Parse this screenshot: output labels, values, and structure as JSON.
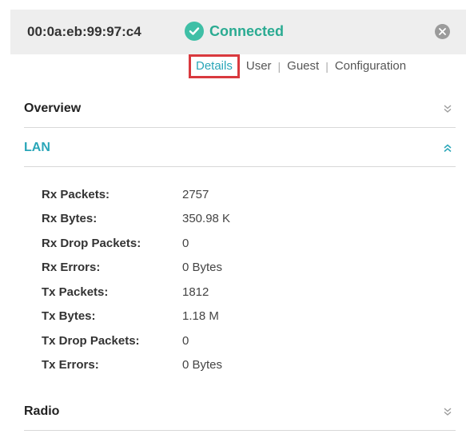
{
  "header": {
    "mac": "00:0a:eb:99:97:c4",
    "status": "Connected",
    "status_color": "#3fbfa6"
  },
  "tabs": [
    {
      "label": "Details",
      "active": true
    },
    {
      "label": "User"
    },
    {
      "label": "Guest"
    },
    {
      "label": "Configuration"
    }
  ],
  "sections": {
    "overview": {
      "title": "Overview",
      "icon": "chevron-double-down-icon"
    },
    "lan": {
      "title": "LAN",
      "icon": "chevron-double-up-icon"
    },
    "radio": {
      "title": "Radio",
      "icon": "chevron-double-down-icon"
    }
  },
  "lan": {
    "rows": [
      {
        "key": "Rx Packets:",
        "value": "2757"
      },
      {
        "key": "Rx Bytes:",
        "value": "350.98 K"
      },
      {
        "key": "Rx Drop Packets:",
        "value": "0"
      },
      {
        "key": "Rx Errors:",
        "value": "0 Bytes"
      },
      {
        "key": "Tx Packets:",
        "value": "1812"
      },
      {
        "key": "Tx Bytes:",
        "value": "1.18 M"
      },
      {
        "key": "Tx Drop Packets:",
        "value": "0"
      },
      {
        "key": "Tx Errors:",
        "value": "0 Bytes"
      }
    ]
  },
  "colors": {
    "accent": "#2aa6b8",
    "connected_text": "#2aab92",
    "tab_highlight_border": "#d9393e"
  }
}
